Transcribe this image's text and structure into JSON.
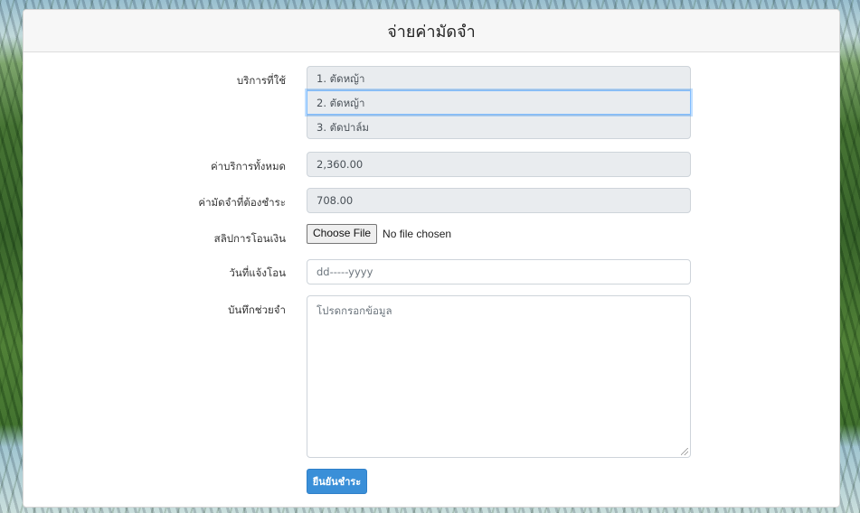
{
  "page": {
    "title": "จ่ายค่ามัดจำ"
  },
  "form": {
    "services": {
      "label": "บริการที่ใช้",
      "items": [
        "1. ตัดหญ้า",
        "2. ตัดหญ้า",
        "3. ตัดปาล์ม"
      ]
    },
    "total_cost": {
      "label": "ค่าบริการทั้งหมด",
      "value": "2,360.00"
    },
    "deposit_due": {
      "label": "ค่ามัดจำที่ต้องชำระ",
      "value": "708.00"
    },
    "transfer_slip": {
      "label": "สลิปการโอนเงิน",
      "button_label": "Choose File",
      "status_text": "No file chosen"
    },
    "transfer_date": {
      "label": "วันที่แจ้งโอน",
      "placeholder": "dd-----yyyy"
    },
    "memo": {
      "label": "บันทึกช่วยจำ",
      "placeholder": "โปรดกรอกข้อมูล"
    },
    "submit_label": "ยืนยันชำระ"
  },
  "colors": {
    "accent": "#3a8fd8",
    "readonly_bg": "#e9ecef",
    "focus_border": "#80bdff"
  }
}
